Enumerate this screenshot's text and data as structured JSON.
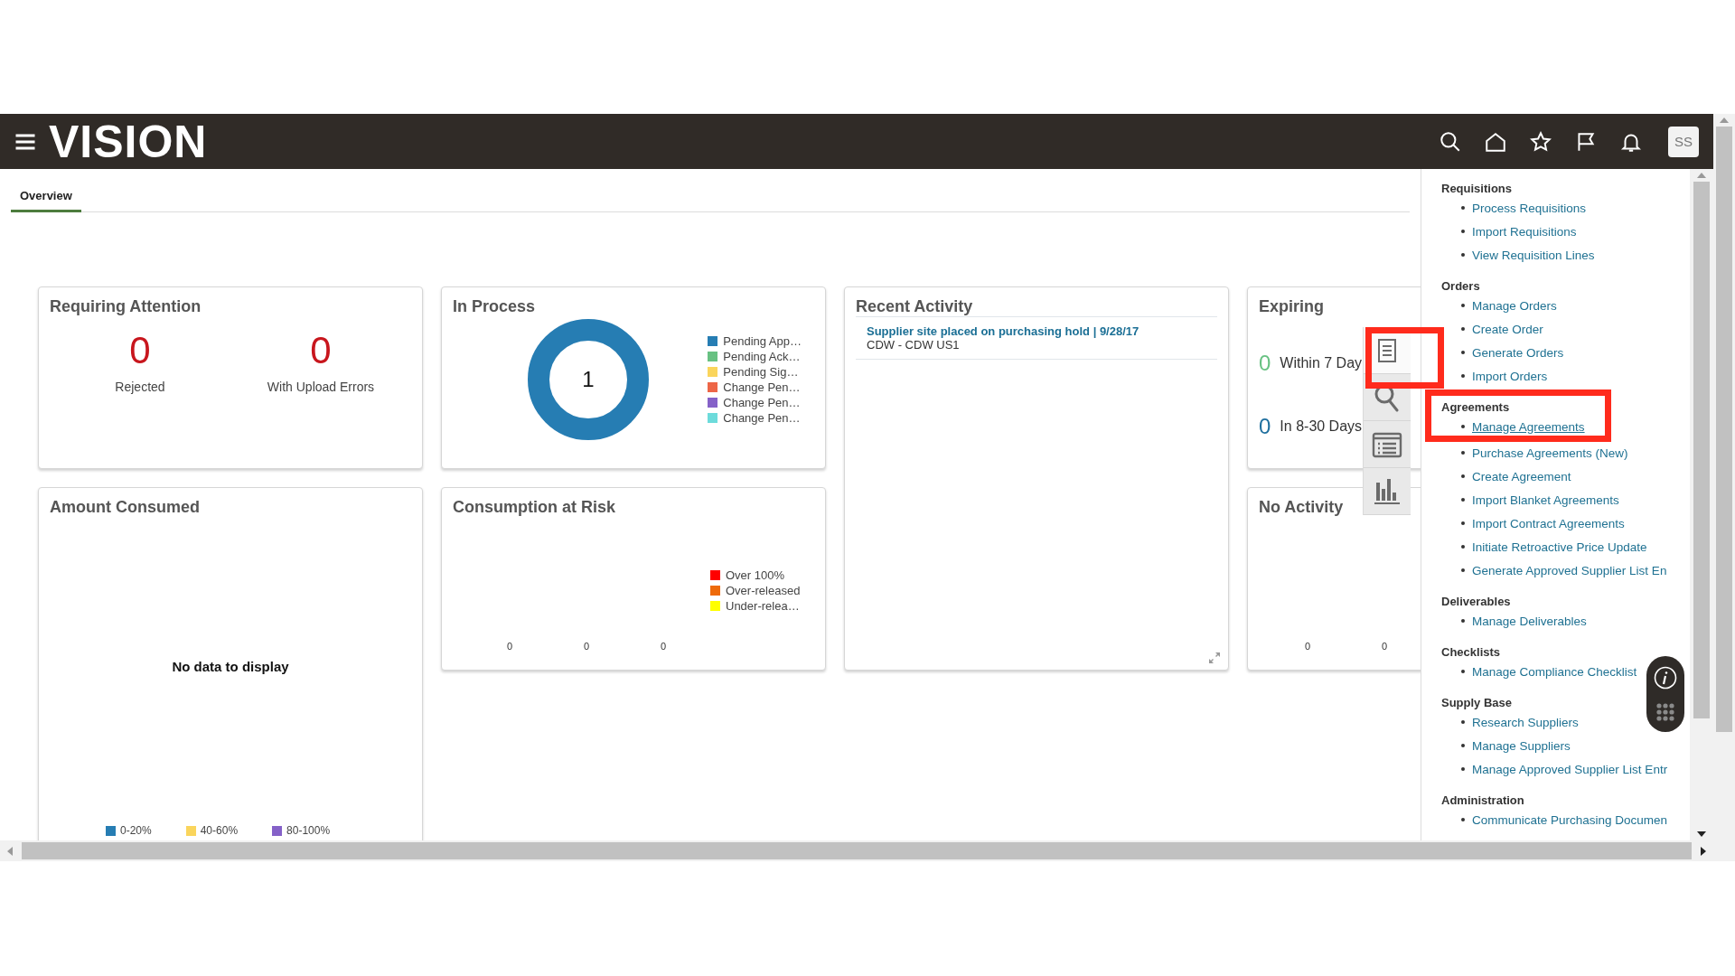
{
  "header": {
    "logo": "VISION",
    "avatar": "SS"
  },
  "tabs": [
    {
      "label": "Overview",
      "selected": true
    }
  ],
  "requiring_attention": {
    "title": "Requiring Attention",
    "metrics": [
      {
        "value": "0",
        "label": "Rejected"
      },
      {
        "value": "0",
        "label": "With Upload Errors"
      }
    ]
  },
  "in_process": {
    "title": "In Process",
    "center_value": "1",
    "legend": [
      {
        "label": "Pending App…",
        "color": "#267db3"
      },
      {
        "label": "Pending Ack…",
        "color": "#68c182"
      },
      {
        "label": "Pending Sig…",
        "color": "#fad55c"
      },
      {
        "label": "Change Pen…",
        "color": "#ed6647"
      },
      {
        "label": "Change Pen…",
        "color": "#8561c8"
      },
      {
        "label": "Change Pen…",
        "color": "#6ddbdb"
      }
    ]
  },
  "recent_activity": {
    "title": "Recent Activity",
    "items": [
      {
        "title": "Supplier site placed on purchasing hold | 9/28/17",
        "detail": "CDW - CDW US1"
      }
    ]
  },
  "expiring": {
    "title": "Expiring",
    "metrics": [
      {
        "value": "0",
        "label": "Within 7 Day",
        "color": "#68c182"
      },
      {
        "value": "0",
        "label": "In 8-30 Days",
        "color": "#1f6f9e"
      }
    ]
  },
  "amount_consumed": {
    "title": "Amount Consumed",
    "message": "No data to display",
    "legend": [
      {
        "label": "0-20%",
        "color": "#267db3"
      },
      {
        "label": "40-60%",
        "color": "#fad55c"
      },
      {
        "label": "80-100%",
        "color": "#8561c8"
      }
    ]
  },
  "consumption_at_risk": {
    "title": "Consumption at Risk",
    "legend": [
      {
        "label": "Over 100%",
        "color": "#ff0000"
      },
      {
        "label": "Over-released",
        "color": "#ee6a0a"
      },
      {
        "label": "Under-relea…",
        "color": "#ffff00"
      }
    ],
    "axis_labels": [
      "0",
      "0",
      "0"
    ]
  },
  "no_activity": {
    "title": "No Activity",
    "axis_labels": [
      "0",
      "0"
    ]
  },
  "side_tools": [
    {
      "kind": "document",
      "selected": true
    },
    {
      "kind": "search",
      "selected": false
    },
    {
      "kind": "list",
      "selected": false
    },
    {
      "kind": "chart",
      "selected": false
    }
  ],
  "task_panel": {
    "sections": [
      {
        "title": "Requisitions",
        "links": [
          {
            "label": "Process Requisitions",
            "hovered": false
          },
          {
            "label": "Import Requisitions",
            "hovered": false
          },
          {
            "label": "View Requisition Lines",
            "hovered": false
          }
        ]
      },
      {
        "title": "Orders",
        "links": [
          {
            "label": "Manage Orders",
            "hovered": false
          },
          {
            "label": "Create Order",
            "hovered": false
          },
          {
            "label": "Generate Orders",
            "hovered": false
          },
          {
            "label": "Import Orders",
            "hovered": false
          }
        ]
      },
      {
        "title": "Agreements",
        "highlighted": true,
        "links": [
          {
            "label": "Manage Agreements",
            "hovered": true
          },
          {
            "label": "Purchase Agreements (New)",
            "hovered": false
          },
          {
            "label": "Create Agreement",
            "hovered": false
          },
          {
            "label": "Import Blanket Agreements",
            "hovered": false
          },
          {
            "label": "Import Contract Agreements",
            "hovered": false
          },
          {
            "label": "Initiate Retroactive Price Update",
            "hovered": false
          },
          {
            "label": "Generate Approved Supplier List En",
            "hovered": false
          }
        ]
      },
      {
        "title": "Deliverables",
        "links": [
          {
            "label": "Manage Deliverables",
            "hovered": false
          }
        ]
      },
      {
        "title": "Checklists",
        "links": [
          {
            "label": "Manage Compliance Checklist",
            "hovered": false
          }
        ]
      },
      {
        "title": "Supply Base",
        "links": [
          {
            "label": "Research Suppliers",
            "hovered": false
          },
          {
            "label": "Manage Suppliers",
            "hovered": false
          },
          {
            "label": "Manage Approved Supplier List Entr",
            "hovered": false
          }
        ]
      },
      {
        "title": "Administration",
        "links": [
          {
            "label": "Communicate Purchasing Documen",
            "hovered": false
          }
        ]
      }
    ]
  }
}
